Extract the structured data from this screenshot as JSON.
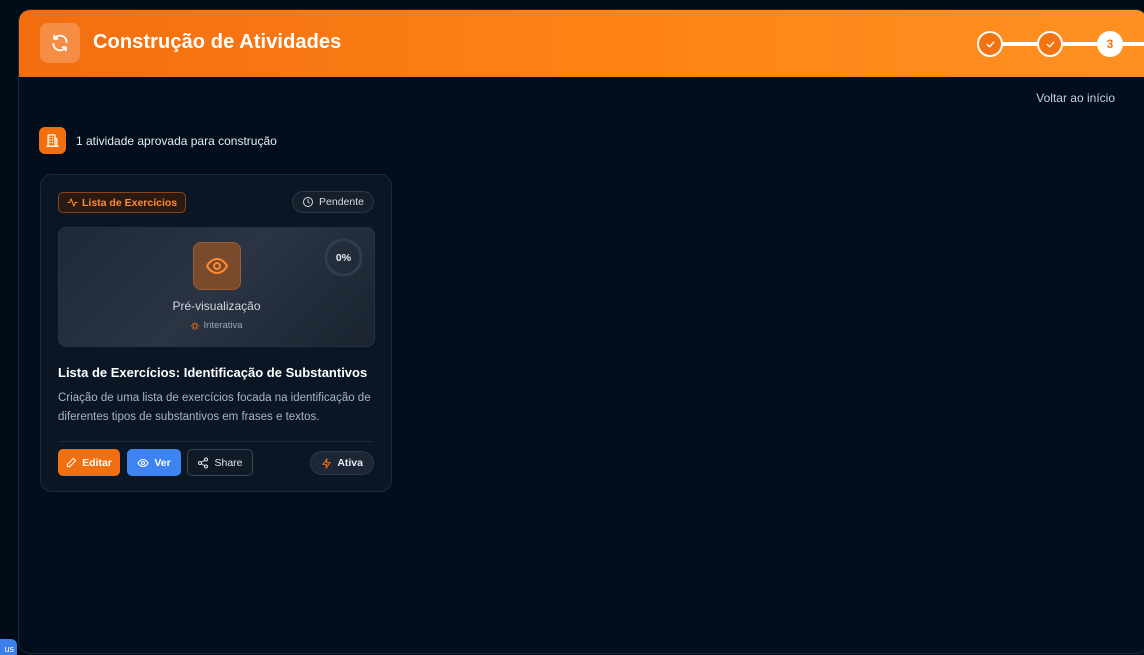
{
  "header": {
    "title": "Construção de Atividades",
    "icon": "refresh-icon",
    "stepper": {
      "steps": [
        {
          "state": "done",
          "icon": "check-icon"
        },
        {
          "state": "done",
          "icon": "check-icon"
        },
        {
          "state": "current",
          "label": "3"
        }
      ]
    }
  },
  "nav": {
    "back_label": "Voltar ao início"
  },
  "summary": {
    "icon": "building-icon",
    "text": "1 atividade aprovada para construção"
  },
  "card": {
    "type_tag": "Lista de Exercícios",
    "status": "Pendente",
    "preview": {
      "title": "Pré-visualização",
      "subtitle": "Interativa",
      "progress": "0%",
      "progress_value": 0
    },
    "title": "Lista de Exercícios: Identificação de Substantivos",
    "description": "Criação de uma lista de exercícios focada na identificação de diferentes tipos de substantivos em frases e textos.",
    "actions": {
      "edit_label": "Editar",
      "view_label": "Ver",
      "share_label": "Share"
    },
    "active_label": "Ativa"
  },
  "floating": {
    "label": "us"
  },
  "colors": {
    "accent": "#f26d0f",
    "accent_light": "#ff9022",
    "blue": "#3e83f2",
    "background": "#010c19",
    "card": "#0b1624"
  }
}
